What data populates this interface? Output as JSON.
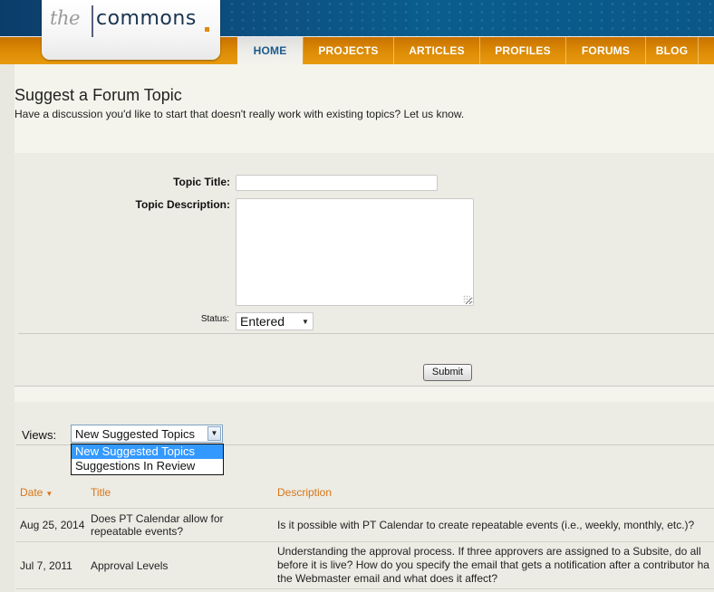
{
  "brand": {
    "logo_the": "the",
    "logo_commons": "commons",
    "accent": "#e08a10",
    "header_blue": "#0c4f80",
    "nav_orange": "#dd8c06"
  },
  "nav": {
    "items": [
      {
        "label": "HOME",
        "active": true
      },
      {
        "label": "PROJECTS",
        "active": false
      },
      {
        "label": "ARTICLES",
        "active": false
      },
      {
        "label": "PROFILES",
        "active": false
      },
      {
        "label": "FORUMS",
        "active": false
      },
      {
        "label": "BLOG",
        "active": false
      }
    ]
  },
  "page": {
    "title": "Suggest a Forum Topic",
    "subtitle": "Have a discussion you'd like to start that doesn't really work with existing topics?  Let us know."
  },
  "form": {
    "title_label": "Topic Title:",
    "title_value": "",
    "description_label": "Topic Description:",
    "description_value": "",
    "status_label": "Status:",
    "status_value": "Entered",
    "submit_label": "Submit"
  },
  "views": {
    "label": "Views:",
    "selected": "New Suggested Topics",
    "options": [
      "New Suggested Topics",
      "Suggestions In Review"
    ],
    "highlighted_index": 0
  },
  "table": {
    "columns": [
      {
        "label": "Date",
        "sorted": "desc"
      },
      {
        "label": "Title"
      },
      {
        "label": "Description"
      }
    ],
    "header_color": "#d6761a",
    "rows": [
      {
        "date": "Aug 25, 2014",
        "title_lines": [
          "Does PT Calendar allow for",
          "repeatable events?"
        ],
        "description_lines": [
          "Is it possible with PT Calendar to create repeatable events (i.e., weekly, monthly, etc.)?"
        ]
      },
      {
        "date": "Jul 7, 2011",
        "title_lines": [
          "Approval Levels"
        ],
        "description_lines": [
          "Understanding the approval process. If three approvers are assigned to a Subsite, do all",
          "before it is live? How do you specify the email that gets a notification after a contributor ha",
          "the Webmaster email and what does it affect?"
        ]
      }
    ]
  }
}
